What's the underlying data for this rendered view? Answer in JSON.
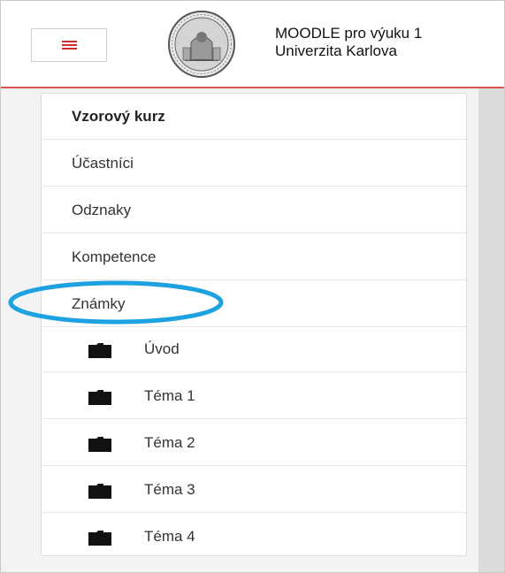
{
  "header": {
    "menu_label": "Toggle navigation",
    "site_name_line1": "MOODLE pro výuku 1",
    "site_name_line2": "Univerzita Karlova",
    "accent_color": "#c9302c",
    "logo_icon": "university-seal-icon"
  },
  "nav": {
    "course_title": "Vzorový kurz",
    "items": [
      {
        "label": "Účastníci"
      },
      {
        "label": "Odznaky"
      },
      {
        "label": "Kompetence"
      },
      {
        "label": "Známky"
      }
    ],
    "sections": [
      {
        "label": "Úvod",
        "icon": "folder-icon"
      },
      {
        "label": "Téma 1",
        "icon": "folder-icon"
      },
      {
        "label": "Téma 2",
        "icon": "folder-icon"
      },
      {
        "label": "Téma 3",
        "icon": "folder-icon"
      },
      {
        "label": "Téma 4",
        "icon": "folder-icon"
      }
    ],
    "highlight_color": "#1ea1e0"
  }
}
